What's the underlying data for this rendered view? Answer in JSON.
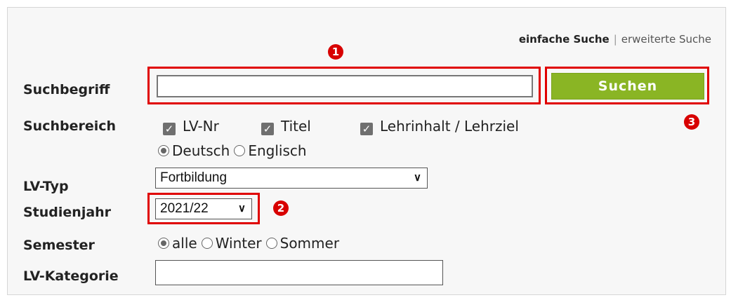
{
  "mode_links": {
    "simple": "einfache Suche",
    "separator": "|",
    "advanced": "erweiterte Suche"
  },
  "labels": {
    "suchbegriff": "Suchbegriff",
    "suchbereich": "Suchbereich",
    "lv_typ": "LV-Typ",
    "studienjahr": "Studienjahr",
    "semester": "Semester",
    "lv_kategorie": "LV-Kategorie"
  },
  "search": {
    "value": "",
    "button_label": "Suchen"
  },
  "suchbereich_checks": [
    {
      "label": "LV-Nr",
      "checked": true
    },
    {
      "label": "Titel",
      "checked": true
    },
    {
      "label": "Lehrinhalt / Lehrziel",
      "checked": true
    }
  ],
  "language_radios": [
    {
      "label": "Deutsch",
      "checked": true
    },
    {
      "label": "Englisch",
      "checked": false
    }
  ],
  "lv_typ": {
    "selected": "Fortbildung"
  },
  "studienjahr": {
    "selected": "2021/22"
  },
  "semester_radios": [
    {
      "label": "alle",
      "checked": true
    },
    {
      "label": "Winter",
      "checked": false
    },
    {
      "label": "Sommer",
      "checked": false
    }
  ],
  "lv_kategorie": {
    "value": ""
  },
  "annotations": {
    "one": "1",
    "two": "2",
    "three": "3"
  },
  "colors": {
    "accent_green": "#8ab524",
    "highlight_red": "#e00000"
  }
}
